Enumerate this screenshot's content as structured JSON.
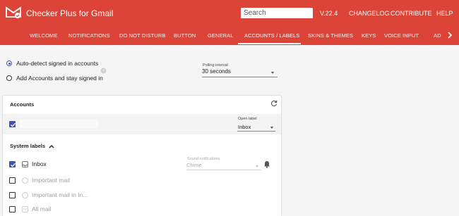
{
  "header": {
    "title": "Checker Plus for Gmail",
    "search_placeholder": "Search",
    "version": "V.22.4",
    "links": [
      "CHANGELOG",
      "CONTRIBUTE",
      "HELP"
    ],
    "brand_color": "#db4437",
    "logo_icon": "envelope-check-icon"
  },
  "nav": {
    "tabs": [
      "WELCOME",
      "NOTIFICATIONS",
      "DO NOT DISTURB",
      "BUTTON",
      "GENERAL",
      "ACCOUNTS / LABELS",
      "SKINS & THEMES",
      "KEYS",
      "VOICE INPUT",
      "AD"
    ],
    "active_tab": "ACCOUNTS / LABELS",
    "more_icon": "chevron-right-icon"
  },
  "options": {
    "auto_detect_label": "Auto-detect signed in accounts",
    "add_accounts_label": "Add Accounts and stay signed in",
    "selected": "auto_detect",
    "help_icon": "help-circle-icon"
  },
  "polling": {
    "label": "Polling interval",
    "value": "30 seconds"
  },
  "accounts": {
    "title": "Accounts",
    "refresh_icon": "refresh-icon",
    "row": {
      "checked": true,
      "name": "",
      "open_label_caption": "Open label",
      "open_label_value": "Inbox"
    }
  },
  "system_labels": {
    "title": "System labels",
    "toggle_icon": "chevron-up-icon",
    "sound_caption": "Sound notifications",
    "sound_value": "Chime",
    "bell_icon": "bell-icon",
    "items": [
      {
        "label": "Inbox",
        "checked": true,
        "icon": "inbox-icon"
      },
      {
        "label": "Important mail",
        "checked": false,
        "icon": "important-icon"
      },
      {
        "label": "Important mail in In...",
        "checked": false,
        "icon": "important-icon"
      },
      {
        "label": "All mail",
        "checked": false,
        "icon": "all-mail-icon"
      }
    ]
  }
}
